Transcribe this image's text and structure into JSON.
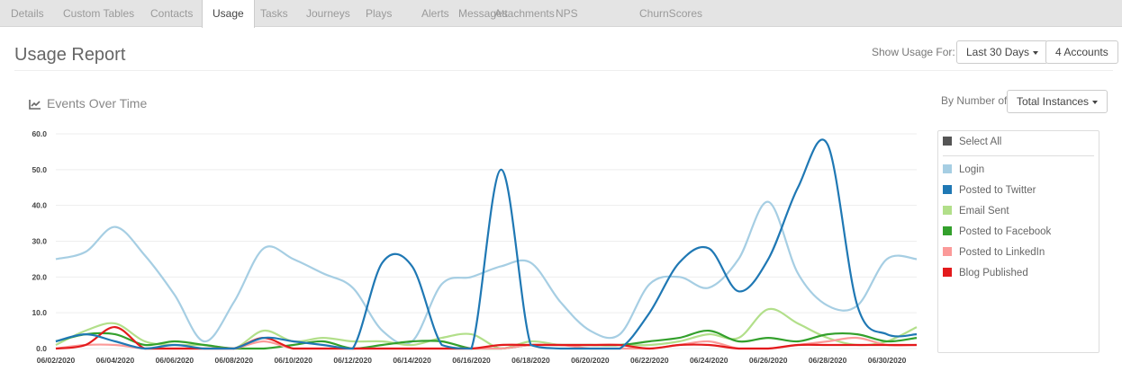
{
  "tabs": [
    {
      "label": "Details",
      "name": "tab-details",
      "active": false
    },
    {
      "label": "Custom Tables",
      "name": "tab-custom-tables",
      "active": false
    },
    {
      "label": "Contacts",
      "name": "tab-contacts",
      "active": false
    },
    {
      "label": "Usage",
      "name": "tab-usage",
      "active": true
    },
    {
      "label": "Tasks",
      "name": "tab-tasks",
      "active": false
    },
    {
      "label": "Journeys",
      "name": "tab-journeys",
      "active": false
    },
    {
      "label": "Plays",
      "name": "tab-plays",
      "active": false
    },
    {
      "label": "Alerts",
      "name": "tab-alerts",
      "active": false
    },
    {
      "label": "Messages",
      "name": "tab-messages",
      "active": false
    },
    {
      "label": "Attachments",
      "name": "tab-attachments",
      "active": false
    },
    {
      "label": "NPS",
      "name": "tab-nps",
      "active": false
    },
    {
      "label": "ChurnScores",
      "name": "tab-churnscores",
      "active": false
    }
  ],
  "header": {
    "title": "Usage Report",
    "show_usage_label": "Show Usage For:",
    "period_button": "Last 30 Days",
    "accounts_button": "4 Accounts"
  },
  "chart_section": {
    "title": "Events Over Time",
    "title_icon": "line-chart-icon",
    "by_number_label": "By Number of",
    "metric_button": "Total Instances"
  },
  "legend": {
    "select_all": "Select All",
    "select_all_color": "#555555"
  },
  "chart_data": {
    "type": "line",
    "ylim": [
      0,
      60
    ],
    "y_ticks": [
      "0.0",
      "10.0",
      "20.0",
      "30.0",
      "40.0",
      "50.0",
      "60.0"
    ],
    "x_tick_labels": [
      "06/02/2020",
      "06/04/2020",
      "06/06/2020",
      "06/08/2020",
      "06/10/2020",
      "06/12/2020",
      "06/14/2020",
      "06/16/2020",
      "06/18/2020",
      "06/20/2020",
      "06/22/2020",
      "06/24/2020",
      "06/26/2020",
      "06/28/2020",
      "06/30/2020"
    ],
    "x": [
      "06/02/2020",
      "06/03/2020",
      "06/04/2020",
      "06/05/2020",
      "06/06/2020",
      "06/07/2020",
      "06/08/2020",
      "06/09/2020",
      "06/10/2020",
      "06/11/2020",
      "06/12/2020",
      "06/13/2020",
      "06/14/2020",
      "06/15/2020",
      "06/16/2020",
      "06/17/2020",
      "06/18/2020",
      "06/19/2020",
      "06/20/2020",
      "06/21/2020",
      "06/22/2020",
      "06/23/2020",
      "06/24/2020",
      "06/25/2020",
      "06/26/2020",
      "06/27/2020",
      "06/28/2020",
      "06/29/2020",
      "06/30/2020",
      "07/01/2020"
    ],
    "grid": true,
    "series": [
      {
        "name": "Login",
        "color": "#a6cee3",
        "values": [
          25,
          27,
          34,
          26,
          15,
          2,
          13,
          28,
          25,
          21,
          17,
          5,
          2,
          18,
          20,
          23,
          24,
          13,
          5,
          4,
          18,
          20,
          17,
          25,
          41,
          21,
          12,
          12,
          25,
          25
        ]
      },
      {
        "name": "Posted to Twitter",
        "color": "#1f78b4",
        "values": [
          2,
          4,
          2,
          0,
          1,
          0,
          0,
          3,
          2,
          1,
          0,
          24,
          23,
          1,
          0,
          50,
          1,
          0,
          0,
          0,
          10,
          24,
          28,
          16,
          25,
          45,
          57,
          12,
          4,
          4
        ]
      },
      {
        "name": "Email Sent",
        "color": "#b2df8a",
        "values": [
          1,
          5,
          7,
          2,
          1,
          1,
          0,
          5,
          2,
          3,
          2,
          2,
          1,
          3,
          4,
          0,
          2,
          1,
          1,
          1,
          1,
          2,
          4,
          3,
          11,
          7,
          3,
          1,
          2,
          6
        ]
      },
      {
        "name": "Posted to Facebook",
        "color": "#33a02c",
        "values": [
          2,
          4,
          4,
          1,
          2,
          1,
          0,
          0,
          1,
          2,
          0,
          1,
          2,
          2,
          0,
          0,
          1,
          1,
          1,
          1,
          2,
          3,
          5,
          2,
          3,
          2,
          4,
          4,
          2,
          3
        ]
      },
      {
        "name": "Posted to LinkedIn",
        "color": "#fb9a99",
        "values": [
          0,
          1,
          1,
          0,
          0,
          0,
          0,
          2,
          0,
          0,
          0,
          0,
          0,
          0,
          0,
          0,
          1,
          1,
          0,
          0,
          0,
          1,
          2,
          0,
          0,
          1,
          2,
          3,
          1,
          1
        ]
      },
      {
        "name": "Blog Published",
        "color": "#e31a1c",
        "values": [
          0,
          1,
          6,
          0,
          0,
          0,
          0,
          3,
          0,
          0,
          0,
          0,
          0,
          0,
          0,
          1,
          1,
          1,
          1,
          1,
          0,
          1,
          1,
          0,
          0,
          1,
          1,
          1,
          1,
          1
        ]
      }
    ]
  }
}
